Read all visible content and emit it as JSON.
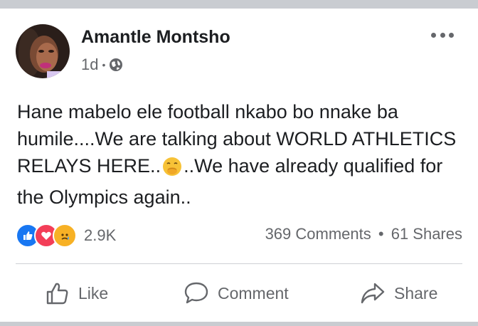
{
  "post": {
    "author": "Amantle Montsho",
    "time": "1d",
    "privacy_icon": "globe-icon",
    "text_before_emoji": "Hane mabelo ele football nkabo bo nnake ba humile....We are talking about WORLD ATHLETICS RELAYS HERE..",
    "emoji": "face-with-hand-over-mouth-emoji",
    "text_after_emoji": "..We have already qualified for the Olympics again.."
  },
  "reactions": {
    "icons": [
      "like-reaction-icon",
      "love-reaction-icon",
      "sad-reaction-icon"
    ],
    "count": "2.9K"
  },
  "stats": {
    "comments": "369 Comments",
    "separator": "•",
    "shares": "61 Shares"
  },
  "actions": {
    "like": "Like",
    "comment": "Comment",
    "share": "Share"
  },
  "colors": {
    "like_blue": "#1877f2",
    "love_red": "#f33e58",
    "sad_yellow": "#f7b125",
    "muted_text": "#65676b"
  }
}
